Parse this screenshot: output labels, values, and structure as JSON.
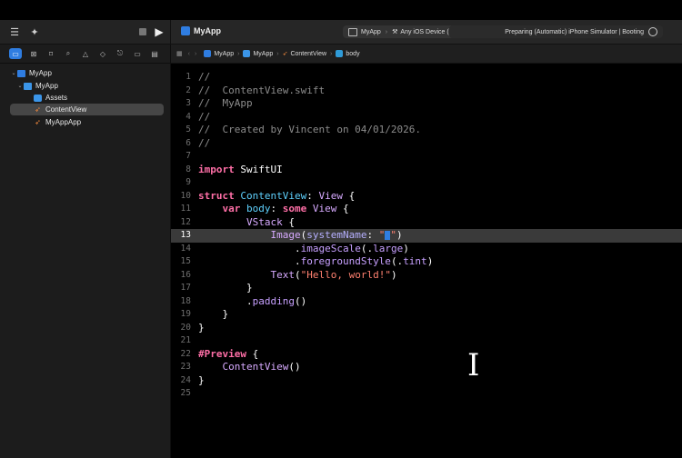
{
  "toolbar": {
    "project_name": "MyApp",
    "scheme": "MyApp",
    "destination": "Any iOS Device (arm64)",
    "status": "Preparing (Automatic) iPhone Simulator | Booting"
  },
  "navigator": {
    "tabs": [
      "folder-icon",
      "warning-square-icon",
      "bookmark-icon",
      "search-icon",
      "issue-icon",
      "test-icon",
      "debug-icon",
      "breakpoint-icon",
      "report-icon"
    ],
    "tree": [
      {
        "label": "MyApp",
        "level": 0,
        "icon": "project"
      },
      {
        "label": "MyApp",
        "level": 1,
        "icon": "folder"
      },
      {
        "label": "Assets",
        "level": 2,
        "icon": "assets"
      },
      {
        "label": "ContentView",
        "level": 2,
        "icon": "swift",
        "selected": true
      },
      {
        "label": "MyAppApp",
        "level": 2,
        "icon": "swift"
      }
    ]
  },
  "jumpbar": [
    "MyApp",
    "MyApp",
    "ContentView",
    "body"
  ],
  "editor": {
    "current_line": 13,
    "line_numbers": [
      "1",
      "2",
      "3",
      "4",
      "5",
      "6",
      "7",
      "8",
      "9",
      "10",
      "11",
      "12",
      "13",
      "14",
      "15",
      "16",
      "17",
      "18",
      "19",
      "20",
      "21",
      "22",
      "23",
      "24",
      "25"
    ]
  }
}
